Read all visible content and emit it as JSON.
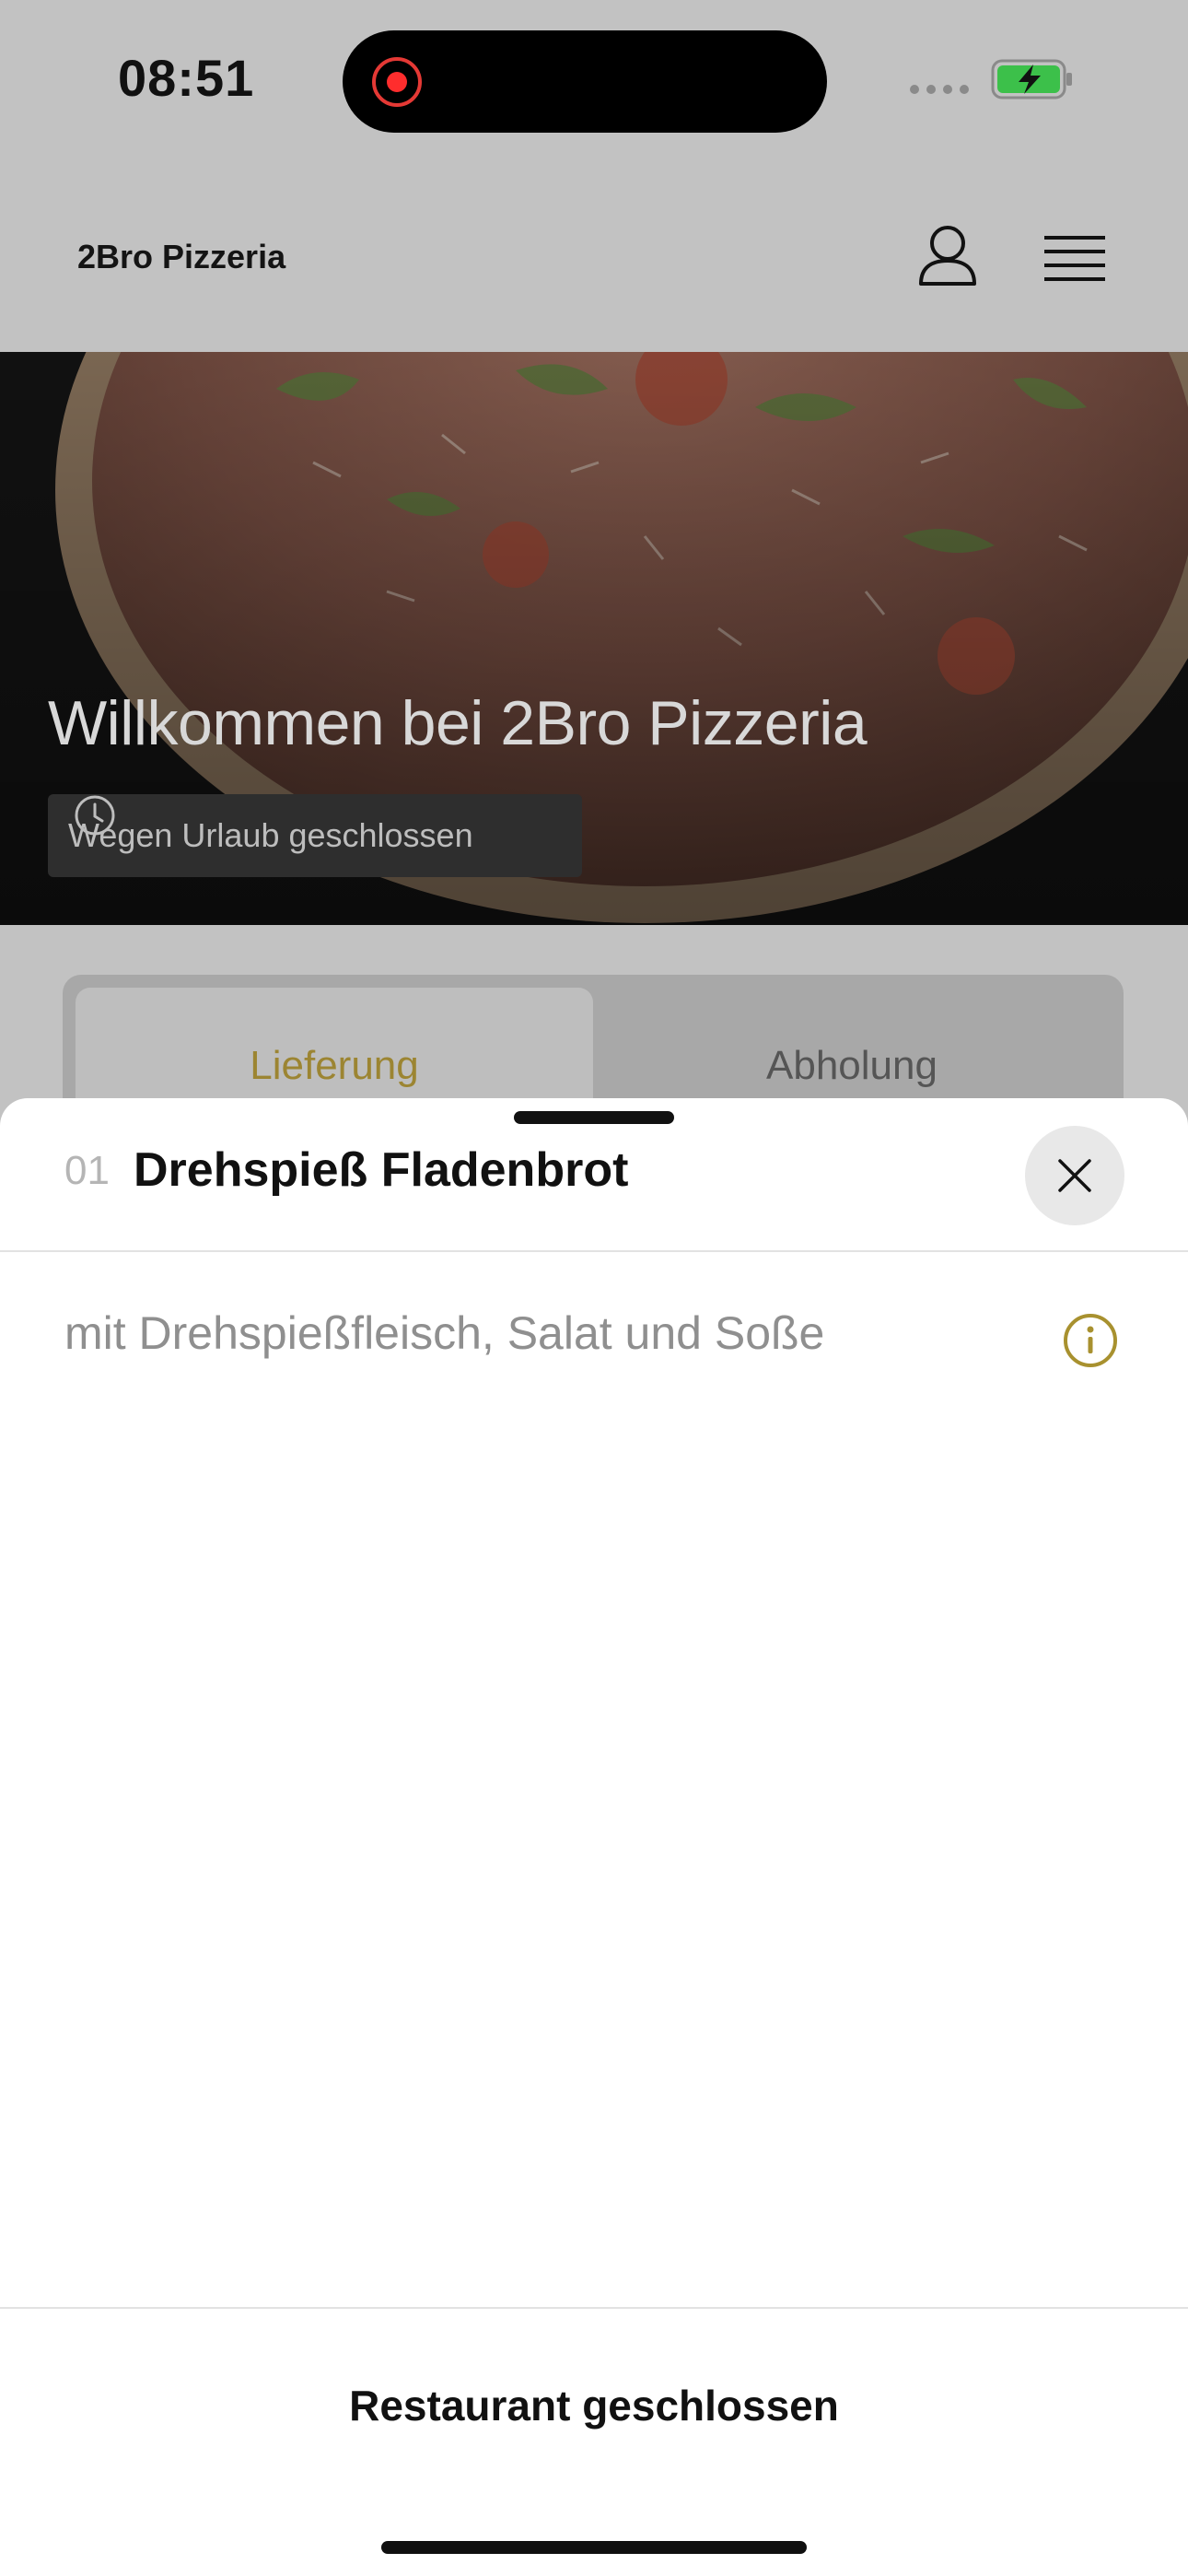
{
  "status_bar": {
    "time": "08:51"
  },
  "header": {
    "brand": "2Bro Pizzeria"
  },
  "hero": {
    "title": "Willkommen bei 2Bro Pizzeria",
    "status": "Wegen Urlaub geschlossen"
  },
  "tabs": [
    {
      "label": "Lieferung",
      "active": true
    },
    {
      "label": "Abholung",
      "active": false
    }
  ],
  "sheet": {
    "item_number": "01",
    "item_title": "Drehspieß Fladenbrot",
    "item_description": "mit Drehspießfleisch, Salat und Soße",
    "footer_label": "Restaurant geschlossen"
  },
  "colors": {
    "accent": "#a8912f",
    "overlay": "#c2c2c2",
    "sheet_bg": "#ffffff"
  },
  "icons": [
    "user-icon",
    "menu-icon",
    "clock-icon",
    "close-icon",
    "info-icon",
    "battery-charging-icon",
    "screen-recording-icon"
  ]
}
